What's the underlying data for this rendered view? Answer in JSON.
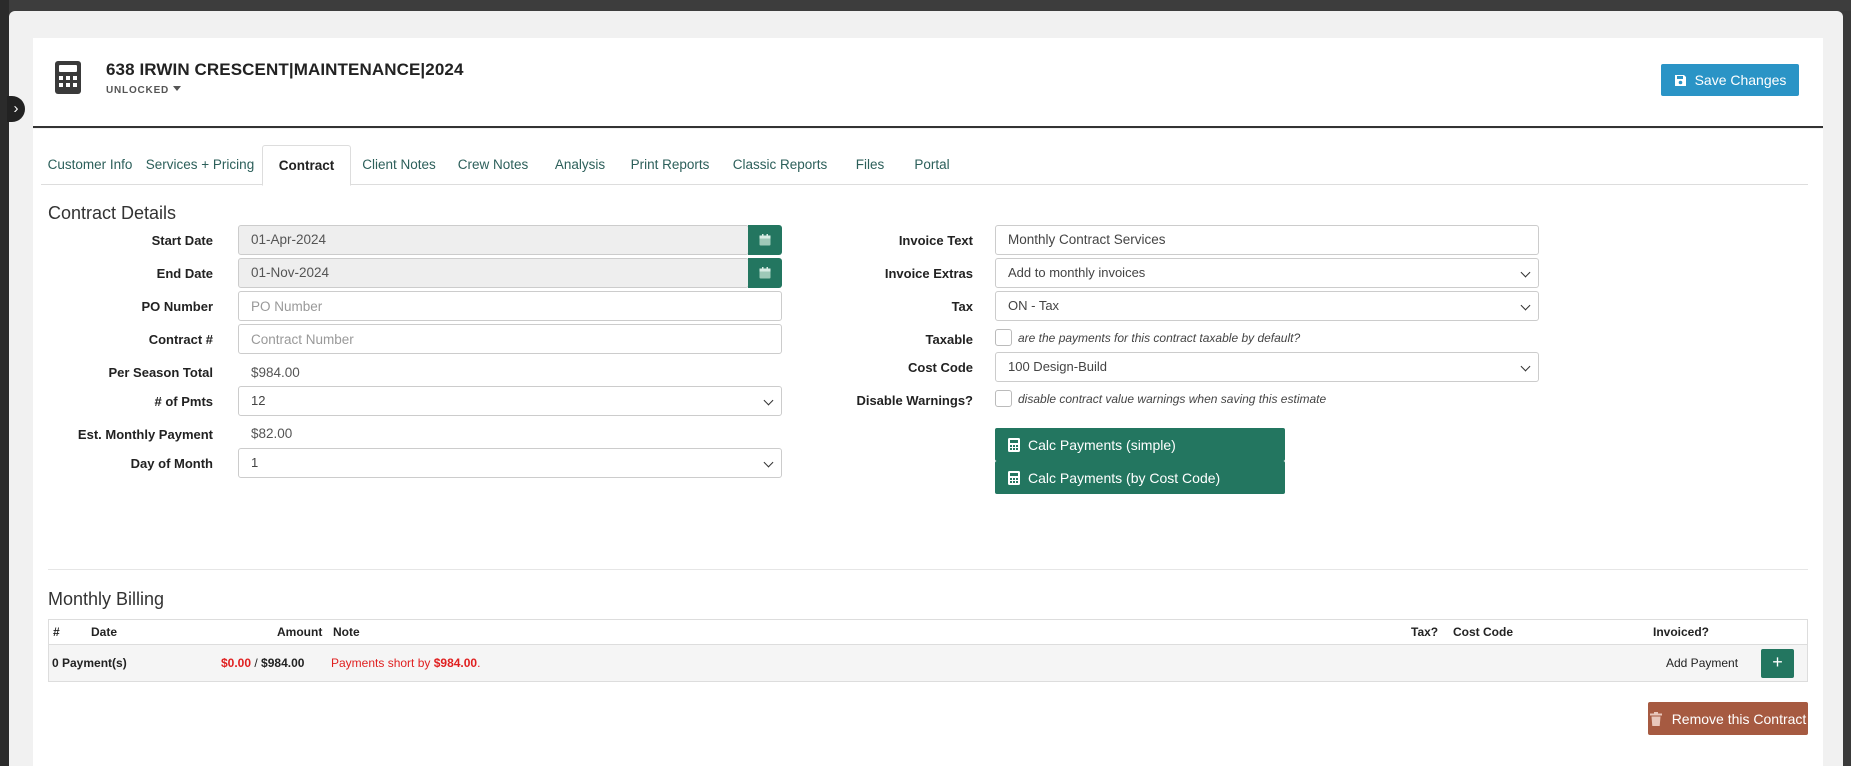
{
  "header": {
    "title": "638 IRWIN CRESCENT|MAINTENANCE|2024",
    "lock_status": "UNLOCKED",
    "save_label": "Save Changes"
  },
  "tabs": [
    {
      "label": "Customer Info"
    },
    {
      "label": "Services + Pricing"
    },
    {
      "label": "Contract",
      "active": true
    },
    {
      "label": "Client Notes"
    },
    {
      "label": "Crew Notes"
    },
    {
      "label": "Analysis"
    },
    {
      "label": "Print Reports"
    },
    {
      "label": "Classic Reports"
    },
    {
      "label": "Files"
    },
    {
      "label": "Portal"
    }
  ],
  "contract_details": {
    "title": "Contract Details",
    "start_date": {
      "label": "Start Date",
      "value": "01-Apr-2024"
    },
    "end_date": {
      "label": "End Date",
      "value": "01-Nov-2024"
    },
    "po_number": {
      "label": "PO Number",
      "placeholder": "PO Number",
      "value": ""
    },
    "contract_number": {
      "label": "Contract #",
      "placeholder": "Contract Number",
      "value": ""
    },
    "per_season_total": {
      "label": "Per Season Total",
      "value": "$984.00"
    },
    "num_payments": {
      "label": "# of Pmts",
      "value": "12"
    },
    "est_monthly_payment": {
      "label": "Est. Monthly Payment",
      "value": "$82.00"
    },
    "day_of_month": {
      "label": "Day of Month",
      "value": "1"
    },
    "invoice_text": {
      "label": "Invoice Text",
      "value": "Monthly Contract Services"
    },
    "invoice_extras": {
      "label": "Invoice Extras",
      "value": "Add to monthly invoices"
    },
    "tax": {
      "label": "Tax",
      "value": "ON - Tax"
    },
    "taxable": {
      "label": "Taxable",
      "text": "are the payments for this contract taxable by default?",
      "checked": false
    },
    "cost_code": {
      "label": "Cost Code",
      "value": "100 Design-Build"
    },
    "disable_warnings": {
      "label": "Disable Warnings?",
      "text": "disable contract value warnings when saving this estimate",
      "checked": false
    },
    "calc_simple_label": "Calc Payments (simple)",
    "calc_cost_code_label": "Calc Payments (by Cost Code)"
  },
  "monthly_billing": {
    "title": "Monthly Billing",
    "columns": [
      "#",
      "Date",
      "Amount",
      "Note",
      "Tax?",
      "Cost Code",
      "Invoiced?"
    ],
    "summary": {
      "count": "0 Payment(s)",
      "paid": "$0.00",
      "separator": " / ",
      "total": "$984.00",
      "note_prefix": "Payments short by ",
      "note_amount": "$984.00",
      "note_suffix": ".",
      "add_label": "Add Payment"
    },
    "remove_label": "Remove this Contract"
  },
  "colors": {
    "primary_blue": "#2a94c6",
    "green": "#237660",
    "danger_red": "#e02020",
    "remove_brown": "#a65a41"
  }
}
